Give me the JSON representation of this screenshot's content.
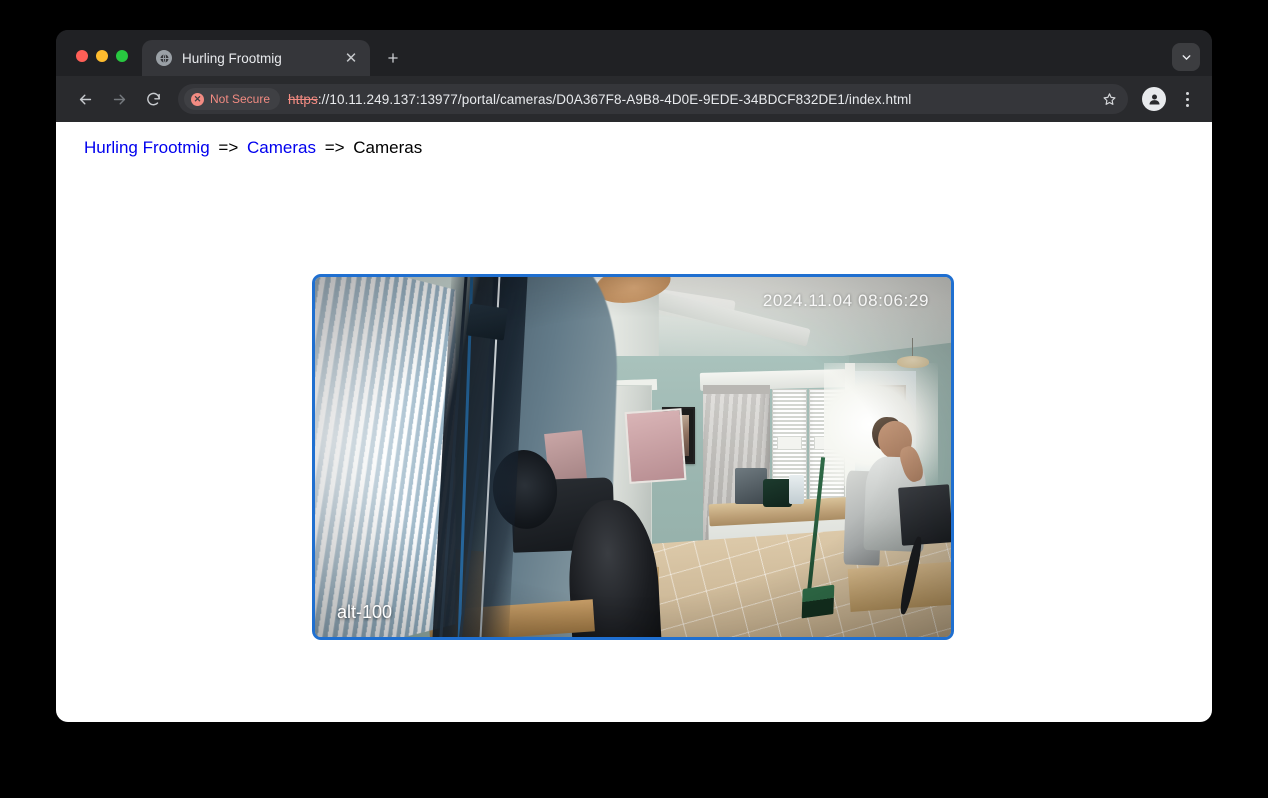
{
  "browser": {
    "traffic_lights": [
      "close",
      "minimize",
      "maximize"
    ],
    "tab": {
      "title": "Hurling Frootmig",
      "favicon_icon": "globe-icon",
      "close_icon": "close-icon"
    },
    "new_tab_label": "+",
    "tab_list_icon": "chevron-down-icon",
    "toolbar": {
      "back_icon": "back-arrow-icon",
      "forward_icon": "forward-arrow-icon",
      "reload_icon": "reload-icon",
      "security_badge": "Not Secure",
      "security_icon": "not-secure-icon",
      "url_scheme": "https",
      "url_rest": "://10.11.249.137:13977/portal/cameras/D0A367F8-A9B8-4D0E-9EDE-34BDCF832DE1/index.html",
      "url_full": "https://10.11.249.137:13977/portal/cameras/D0A367F8-A9B8-4D0E-9EDE-34BDCF832DE1/index.html",
      "bookmark_icon": "star-icon",
      "profile_icon": "account-avatar-icon",
      "menu_icon": "three-dot-menu-icon"
    }
  },
  "page": {
    "breadcrumb": {
      "root": "Hurling Frootmig",
      "separator1": "=>",
      "level2": "Cameras",
      "separator2": "=>",
      "current": "Cameras"
    },
    "camera": {
      "timestamp": "2024.11.04 08:06:29",
      "label": "alt-100",
      "border_color": "#1f6fd0"
    }
  },
  "colors": {
    "link": "#0000ee",
    "not_secure": "#f28b82",
    "camera_border": "#1f6fd0",
    "browser_chrome": "#292a2d",
    "tabstrip": "#202124",
    "active_tab": "#35363a"
  }
}
